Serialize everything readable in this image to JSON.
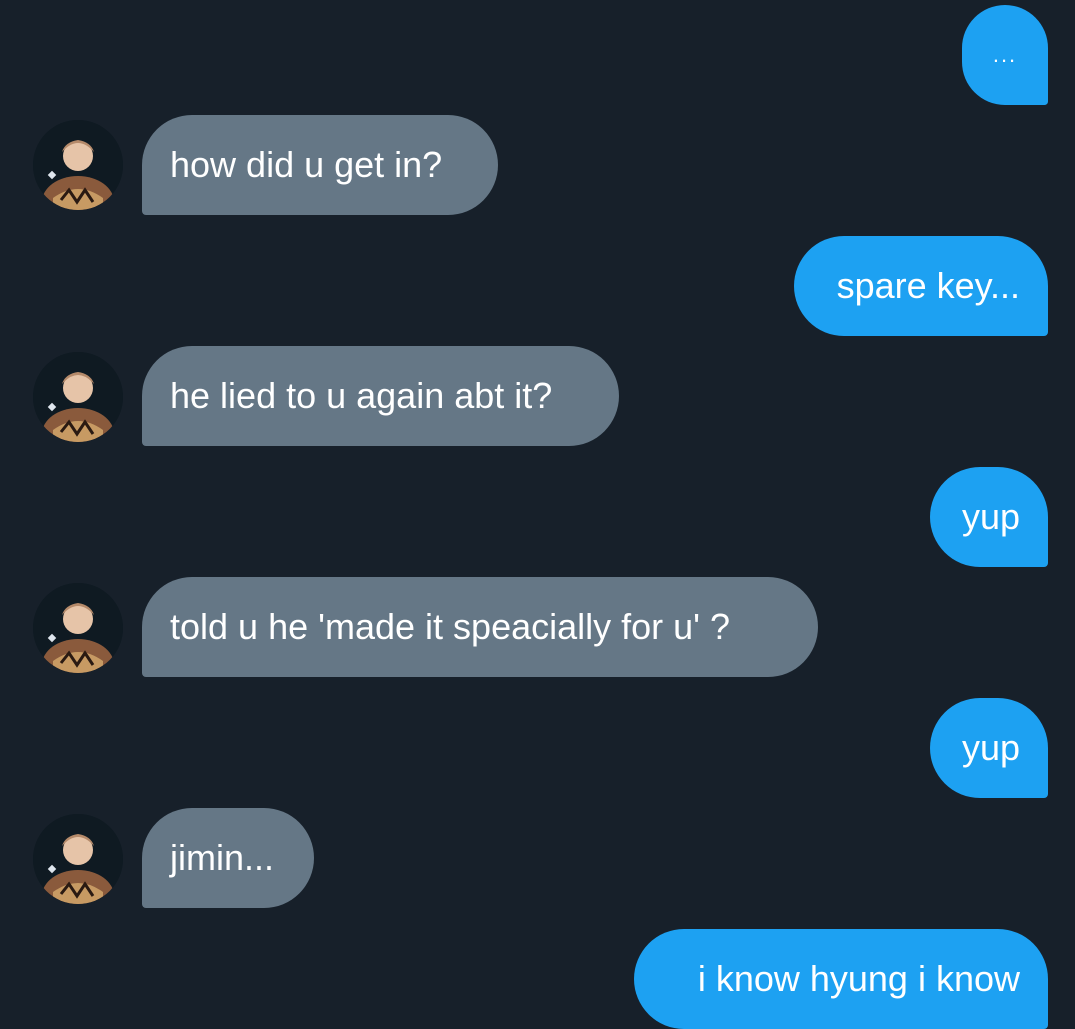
{
  "conversation": {
    "messages": [
      {
        "sender": "me",
        "text": "..."
      },
      {
        "sender": "them",
        "text": "how did u get in?"
      },
      {
        "sender": "me",
        "text": "spare key..."
      },
      {
        "sender": "them",
        "text": "he lied to u again abt it?"
      },
      {
        "sender": "me",
        "text": "yup"
      },
      {
        "sender": "them",
        "text": "told u he 'made it speacially for u' ?"
      },
      {
        "sender": "me",
        "text": "yup"
      },
      {
        "sender": "them",
        "text": "jimin..."
      },
      {
        "sender": "me",
        "text": "i know hyung i know"
      }
    ]
  },
  "colors": {
    "background": "#17202a",
    "sent_bubble": "#1da1f2",
    "received_bubble": "#657786",
    "text": "#ffffff"
  }
}
